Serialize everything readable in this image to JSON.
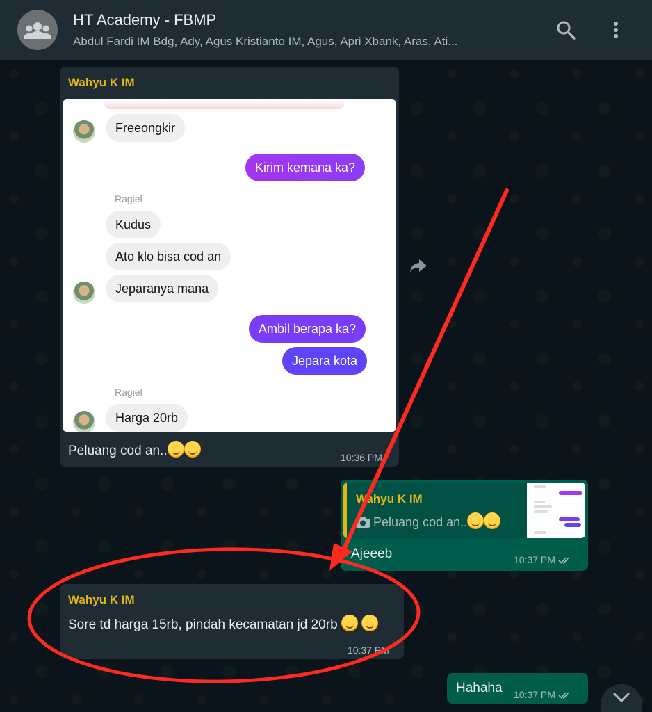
{
  "header": {
    "title": "HT Academy - FBMP",
    "subtitle": "Abdul Fardi IM Bdg, Ady, Agus Kristianto IM, Agus, Apri Xbank, Aras, Ati...",
    "icons": [
      "group-avatar-icon",
      "search-icon",
      "menu-icon"
    ]
  },
  "messages": {
    "m1": {
      "sender": "Wahyu K IM",
      "caption": "Peluang cod an..",
      "time": "10:36 PM",
      "screenshot": {
        "b1": "Freeongkir",
        "b2": "Kirim kemana ka?",
        "name1": "Ragiel",
        "b3": "Kudus",
        "b4": "Ato klo bisa cod an",
        "b5": "Jeparanya mana",
        "b6": "Ambil berapa ka?",
        "b7": "Jepara kota",
        "name2": "Ragiel",
        "b8": "Harga 20rb"
      }
    },
    "m2": {
      "quote_sender": "Wahyu K IM",
      "quote_text": "Peluang cod an..",
      "text": "Ajeeeb",
      "time": "10:37 PM"
    },
    "m3": {
      "sender": "Wahyu K IM",
      "text": "Sore td harga 15rb, pindah kecamatan jd 20rb",
      "time": "10:37 PM"
    },
    "m4": {
      "text": "Hahaha",
      "time": "10:37 PM"
    }
  },
  "colors": {
    "header_bg": "#202c33",
    "incoming_bg": "#202c33",
    "outgoing_bg": "#005c4b",
    "sender_name": "#e2b714",
    "annotation_red": "#ff2a1f"
  }
}
